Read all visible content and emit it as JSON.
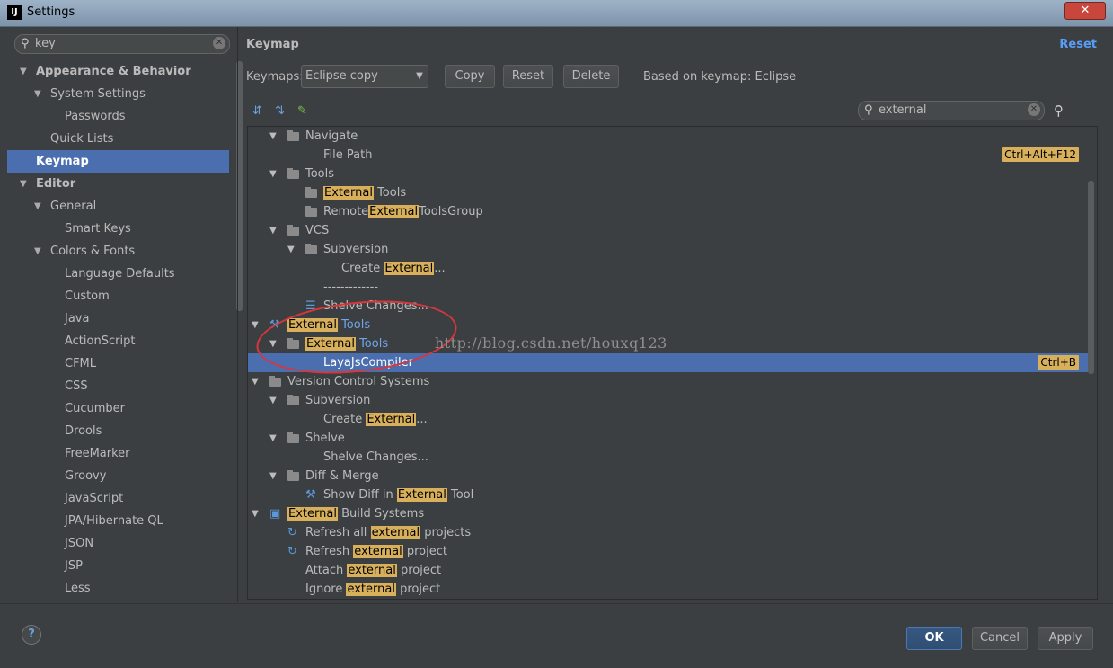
{
  "window": {
    "title": "Settings",
    "app_icon": "IJ",
    "close_label": "✕"
  },
  "sidebar": {
    "search": {
      "value": "key"
    },
    "items": [
      {
        "label": "Appearance & Behavior",
        "bold": true,
        "indent": 0,
        "expanded": true
      },
      {
        "label": "System Settings",
        "indent": 1,
        "expanded": true
      },
      {
        "label": "Passwords",
        "indent": 2
      },
      {
        "label": "Quick Lists",
        "indent": 1
      },
      {
        "label": "Keymap",
        "bold": true,
        "indent": 0,
        "selected": true
      },
      {
        "label": "Editor",
        "bold": true,
        "indent": 0,
        "expanded": true
      },
      {
        "label": "General",
        "indent": 1,
        "expanded": true
      },
      {
        "label": "Smart Keys",
        "indent": 2
      },
      {
        "label": "Colors & Fonts",
        "indent": 1,
        "expanded": true
      },
      {
        "label": "Language Defaults",
        "indent": 2
      },
      {
        "label": "Custom",
        "indent": 2
      },
      {
        "label": "Java",
        "indent": 2
      },
      {
        "label": "ActionScript",
        "indent": 2
      },
      {
        "label": "CFML",
        "indent": 2
      },
      {
        "label": "CSS",
        "indent": 2
      },
      {
        "label": "Cucumber",
        "indent": 2
      },
      {
        "label": "Drools",
        "indent": 2
      },
      {
        "label": "FreeMarker",
        "indent": 2
      },
      {
        "label": "Groovy",
        "indent": 2
      },
      {
        "label": "JavaScript",
        "indent": 2
      },
      {
        "label": "JPA/Hibernate QL",
        "indent": 2
      },
      {
        "label": "JSON",
        "indent": 2
      },
      {
        "label": "JSP",
        "indent": 2
      },
      {
        "label": "Less",
        "indent": 2
      }
    ]
  },
  "keymap": {
    "header": "Keymap",
    "reset_link": "Reset",
    "keymaps_label": "Keymaps:",
    "keymap_selected": "Eclipse copy",
    "copy_button": "Copy",
    "reset_button": "Reset",
    "delete_button": "Delete",
    "based_on": "Based on keymap: Eclipse",
    "filter_value": "external",
    "highlight_color": "#d8b05b",
    "selection_color": "#4b6eaf"
  },
  "tree": [
    {
      "level": 1,
      "arrow": true,
      "icon": "folder",
      "parts": [
        {
          "t": "Navigate"
        }
      ]
    },
    {
      "level": 2,
      "parts": [
        {
          "t": "File Path"
        }
      ],
      "shortcut": "Ctrl+Alt+F12"
    },
    {
      "level": 1,
      "arrow": true,
      "icon": "folder",
      "parts": [
        {
          "t": "Tools"
        }
      ]
    },
    {
      "level": 2,
      "icon": "folder",
      "parts": [
        {
          "t": "External",
          "hl": true
        },
        {
          "t": " Tools"
        }
      ]
    },
    {
      "level": 2,
      "icon": "folder",
      "parts": [
        {
          "t": "Remote"
        },
        {
          "t": "External",
          "hl": true
        },
        {
          "t": "ToolsGroup"
        }
      ]
    },
    {
      "level": 1,
      "arrow": true,
      "icon": "folder",
      "parts": [
        {
          "t": "VCS"
        }
      ]
    },
    {
      "level": 2,
      "arrow": true,
      "icon": "folder",
      "parts": [
        {
          "t": "Subversion"
        }
      ]
    },
    {
      "level": 3,
      "parts": [
        {
          "t": "Create "
        },
        {
          "t": "External",
          "hl": true
        },
        {
          "t": "..."
        }
      ]
    },
    {
      "level": 2,
      "parts": [
        {
          "t": "-------------"
        }
      ]
    },
    {
      "level": 2,
      "icon": "shelve",
      "parts": [
        {
          "t": "Shelve Changes..."
        }
      ]
    },
    {
      "level": 0,
      "arrow": true,
      "icon": "tools",
      "parts": [
        {
          "t": "External",
          "hl": true
        },
        {
          "t": " Tools",
          "blue": true
        }
      ]
    },
    {
      "level": 1,
      "arrow": true,
      "icon": "folder",
      "parts": [
        {
          "t": "External",
          "hl": true
        },
        {
          "t": " Tools",
          "blue": true
        }
      ]
    },
    {
      "level": 2,
      "selected": true,
      "parts": [
        {
          "t": "LayaJsCompiler"
        }
      ],
      "shortcut": "Ctrl+B"
    },
    {
      "level": 0,
      "arrow": true,
      "icon": "folder",
      "parts": [
        {
          "t": "Version Control Systems"
        }
      ]
    },
    {
      "level": 1,
      "arrow": true,
      "icon": "folder",
      "parts": [
        {
          "t": "Subversion"
        }
      ]
    },
    {
      "level": 2,
      "parts": [
        {
          "t": "Create "
        },
        {
          "t": "External",
          "hl": true
        },
        {
          "t": "..."
        }
      ]
    },
    {
      "level": 1,
      "arrow": true,
      "icon": "folder",
      "parts": [
        {
          "t": "Shelve"
        }
      ]
    },
    {
      "level": 2,
      "parts": [
        {
          "t": "Shelve Changes..."
        }
      ]
    },
    {
      "level": 1,
      "arrow": true,
      "icon": "folder",
      "parts": [
        {
          "t": "Diff & Merge"
        }
      ]
    },
    {
      "level": 2,
      "icon": "wrench",
      "parts": [
        {
          "t": "Show Diff in "
        },
        {
          "t": "External",
          "hl": true
        },
        {
          "t": " Tool"
        }
      ]
    },
    {
      "level": 0,
      "arrow": true,
      "icon": "build",
      "parts": [
        {
          "t": "External",
          "hl": true
        },
        {
          "t": " Build Systems"
        }
      ]
    },
    {
      "level": 1,
      "icon": "refresh",
      "parts": [
        {
          "t": "Refresh all "
        },
        {
          "t": "external",
          "hl": true
        },
        {
          "t": " projects"
        }
      ]
    },
    {
      "level": 1,
      "icon": "refresh",
      "parts": [
        {
          "t": "Refresh "
        },
        {
          "t": "external",
          "hl": true
        },
        {
          "t": " project"
        }
      ]
    },
    {
      "level": 1,
      "parts": [
        {
          "t": "Attach "
        },
        {
          "t": "external",
          "hl": true
        },
        {
          "t": " project"
        }
      ]
    },
    {
      "level": 1,
      "parts": [
        {
          "t": "Ignore "
        },
        {
          "t": "external",
          "hl": true
        },
        {
          "t": " project"
        }
      ]
    }
  ],
  "watermark": "http://blog.csdn.net/houxq123",
  "footer": {
    "help_label": "?",
    "ok_label": "OK",
    "cancel_label": "Cancel",
    "apply_label": "Apply"
  }
}
